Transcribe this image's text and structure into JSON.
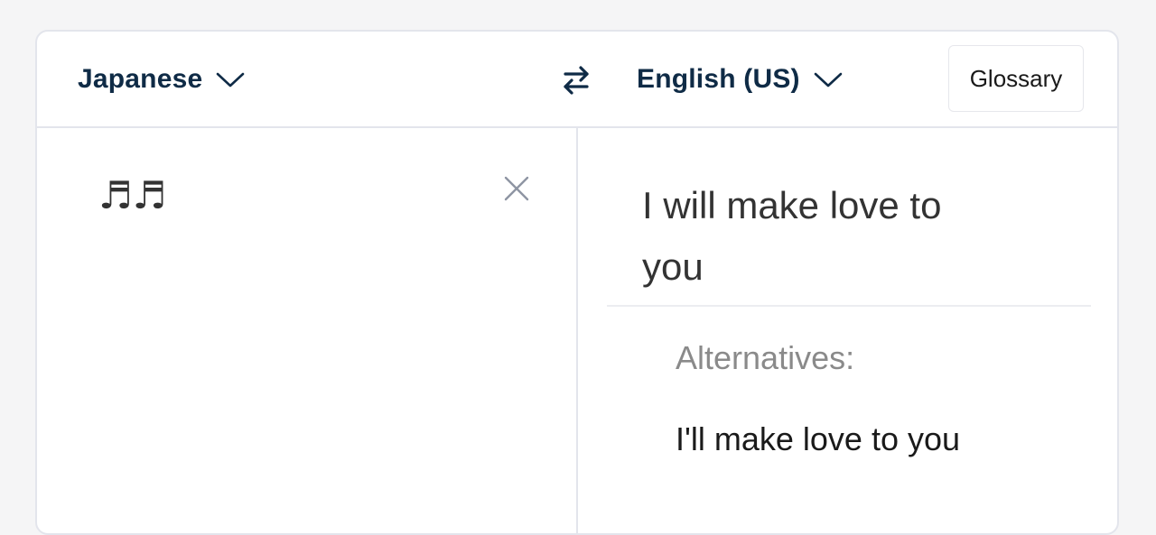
{
  "header": {
    "source_language": "Japanese",
    "target_language": "English (US)",
    "glossary_label": "Glossary"
  },
  "source": {
    "text": "♬♬"
  },
  "target": {
    "translation": "I will make love to you",
    "alternatives_label": "Alternatives:",
    "alternatives": [
      "I'll make love to you"
    ]
  },
  "icons": {
    "source_dropdown": "chevron-down-icon",
    "target_dropdown": "chevron-down-icon",
    "swap": "swap-arrows-icon",
    "clear": "close-icon"
  },
  "colors": {
    "language_text": "#0f2b46",
    "translation_text": "#333333",
    "alternatives_label": "#8a8a8a",
    "border": "#e3e5ec",
    "background": "#f5f5f6"
  }
}
